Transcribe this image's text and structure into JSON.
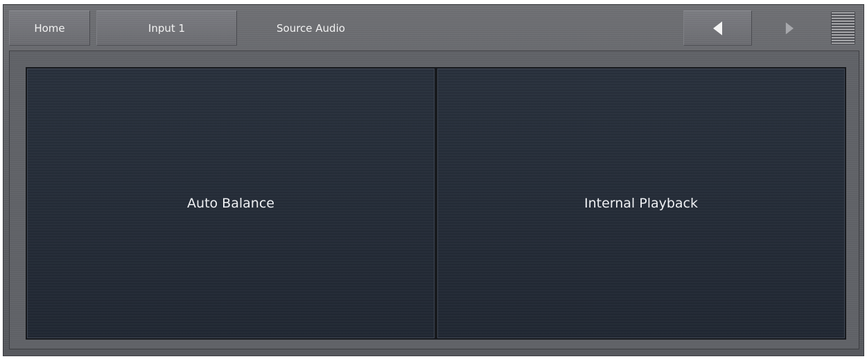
{
  "topbar": {
    "home_label": "Home",
    "input_label": "Input 1",
    "page_title": "Source Audio",
    "back_icon": "triangle-left-icon",
    "forward_icon": "triangle-right-icon",
    "menu_icon": "menu-lines-icon"
  },
  "main": {
    "tiles": [
      {
        "label": "Auto Balance"
      },
      {
        "label": "Internal Playback"
      }
    ]
  },
  "colors": {
    "chrome": "#6a6b70",
    "tile": "#252c37",
    "text": "#f2f2f2"
  }
}
